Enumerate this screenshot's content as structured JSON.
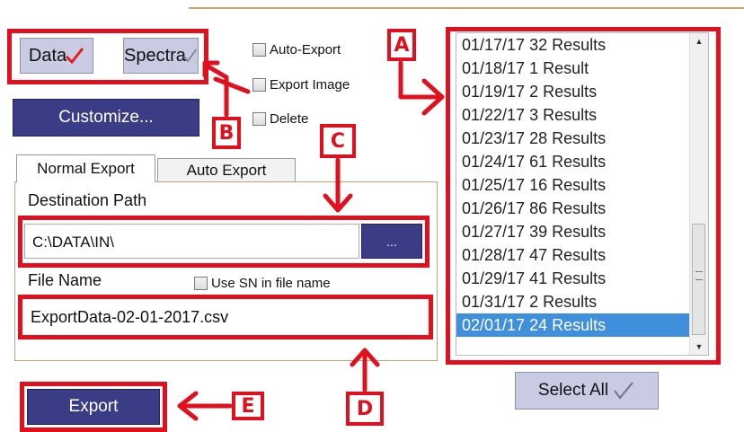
{
  "top_buttons": {
    "data_label": "Data",
    "spectra_label": "Spectra"
  },
  "checkboxes": [
    {
      "label": "Auto-Export",
      "checked": false
    },
    {
      "label": "Export Image",
      "checked": false
    },
    {
      "label": "Delete",
      "checked": false
    }
  ],
  "customize_label": "Customize...",
  "tabs": [
    {
      "label": "Normal Export",
      "active": true
    },
    {
      "label": "Auto Export",
      "active": false
    }
  ],
  "destination": {
    "label": "Destination Path",
    "value": "C:\\DATA\\IN\\",
    "browse_label": "..."
  },
  "file_name": {
    "label": "File Name",
    "use_sn_label": "Use SN in file name",
    "value": "ExportData-02-01-2017.csv"
  },
  "results_list": [
    "01/17/17 32 Results",
    "01/18/17 1 Result",
    "01/19/17 2 Results",
    "01/22/17 3 Results",
    "01/23/17 28 Results",
    "01/24/17 61 Results",
    "01/25/17 16 Results",
    "01/26/17 86 Results",
    "01/27/17 39 Results",
    "01/28/17 47 Results",
    "01/29/17 41 Results",
    "01/31/17 2 Results",
    "02/01/17 24 Results"
  ],
  "selected_result": "02/01/17 24 Results",
  "select_all_label": "Select All",
  "export_label": "Export",
  "callouts": {
    "a": "A",
    "b": "B",
    "c": "C",
    "d": "D",
    "e": "E"
  },
  "colors": {
    "callout_red": "#e0101e",
    "navy_button": "#3a3d86",
    "selection_blue": "#3f8fdc",
    "panel_border": "#c9a46a"
  }
}
